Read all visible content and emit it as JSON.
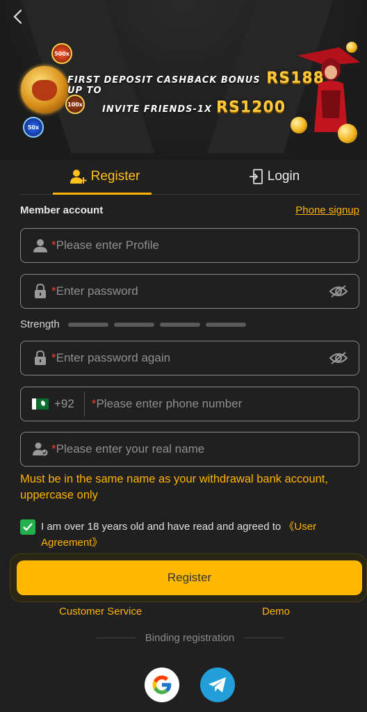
{
  "banner": {
    "line1_text": "FIRST DEPOSIT CASHBACK BONUS UP TO",
    "line1_amount": "RS188",
    "line2_text": "INVITE FRIENDS-1X",
    "line2_amount": "RS1200",
    "badges": [
      "500x",
      "100x",
      "50x"
    ]
  },
  "tabs": {
    "register": "Register",
    "login": "Login"
  },
  "section": {
    "title": "Member account",
    "phone_signup": "Phone signup"
  },
  "form": {
    "required_mark": "*",
    "profile_placeholder": "Please enter Profile",
    "password_placeholder": "Enter password",
    "strength_label": "Strength",
    "password_again_placeholder": "Enter password again",
    "country_code": "+92",
    "phone_placeholder": "Please enter phone number",
    "realname_placeholder": "Please enter your real name"
  },
  "note": "Must be in the same name as your withdrawal bank account, uppercase only",
  "agreement": {
    "text": "I am over 18 years old and have read and agreed to ",
    "link": "《User Agreement》",
    "checked": true
  },
  "register_button": "Register",
  "footer": {
    "customer_service": "Customer Service",
    "demo": "Demo",
    "binding": "Binding registration"
  },
  "colors": {
    "accent": "#ffb800",
    "background": "#202020",
    "required": "#ff3b30",
    "check": "#22b14c"
  }
}
